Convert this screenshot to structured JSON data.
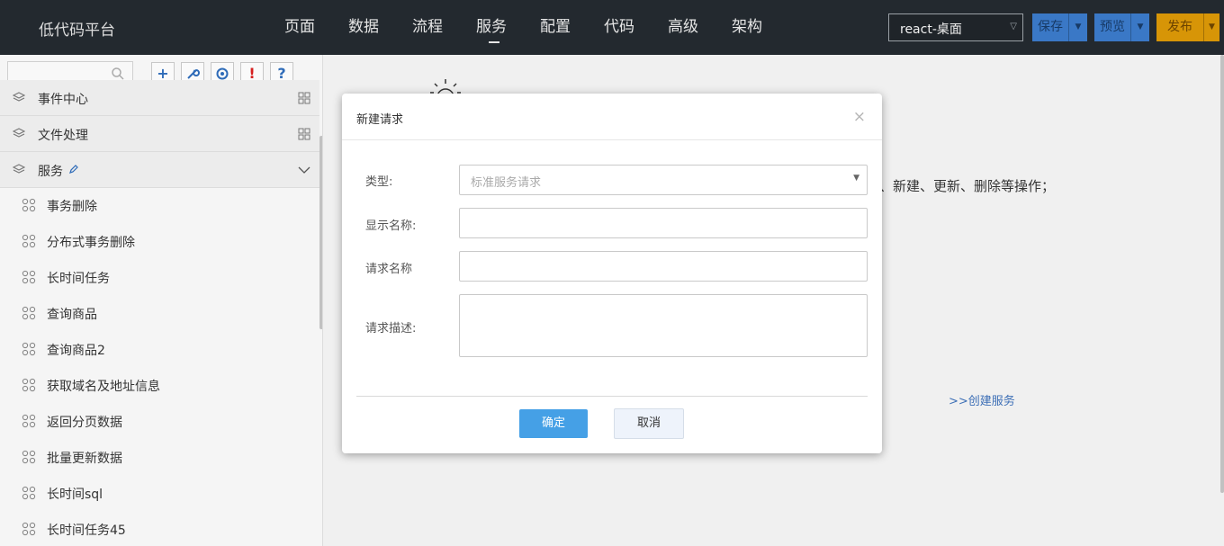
{
  "header": {
    "logo": "低代码平台",
    "nav": [
      {
        "label": "页面"
      },
      {
        "label": "数据"
      },
      {
        "label": "流程"
      },
      {
        "label": "服务",
        "active": true
      },
      {
        "label": "配置"
      },
      {
        "label": "代码"
      },
      {
        "label": "高级"
      },
      {
        "label": "架构"
      }
    ],
    "env_select": "react-桌面",
    "save_label": "保存",
    "preview_label": "预览",
    "publish_label": "发布"
  },
  "sidebar": {
    "search_placeholder": "",
    "tools": [
      "+",
      "wrench",
      "target",
      "!",
      "?"
    ],
    "groups": [
      {
        "label": "事件中心"
      },
      {
        "label": "文件处理"
      },
      {
        "label": "服务"
      }
    ],
    "items": [
      {
        "label": "事务删除"
      },
      {
        "label": "分布式事务删除"
      },
      {
        "label": "长时间任务"
      },
      {
        "label": "查询商品"
      },
      {
        "label": "查询商品2"
      },
      {
        "label": "获取域名及地址信息"
      },
      {
        "label": "返回分页数据"
      },
      {
        "label": "批量更新数据"
      },
      {
        "label": "长时间sql"
      },
      {
        "label": "长时间任务45"
      }
    ]
  },
  "main": {
    "hint_tail": "询、新建、更新、删除等操作；",
    "create_link": ">>创建服务"
  },
  "modal": {
    "title": "新建请求",
    "close_icon": "×",
    "type_label": "类型:",
    "type_value": "标准服务请求",
    "display_name_label": "显示名称:",
    "display_name_value": "",
    "request_name_label": "请求名称",
    "request_name_value": "",
    "description_label": "请求描述:",
    "description_value": "",
    "ok_label": "确定",
    "cancel_label": "取消"
  },
  "colors": {
    "header_bg": "#23292f",
    "primary_blue": "#45a0e6",
    "save_blue": "#3a78c6",
    "publish_orange": "#d79507",
    "link_blue": "#3d6fb6"
  }
}
